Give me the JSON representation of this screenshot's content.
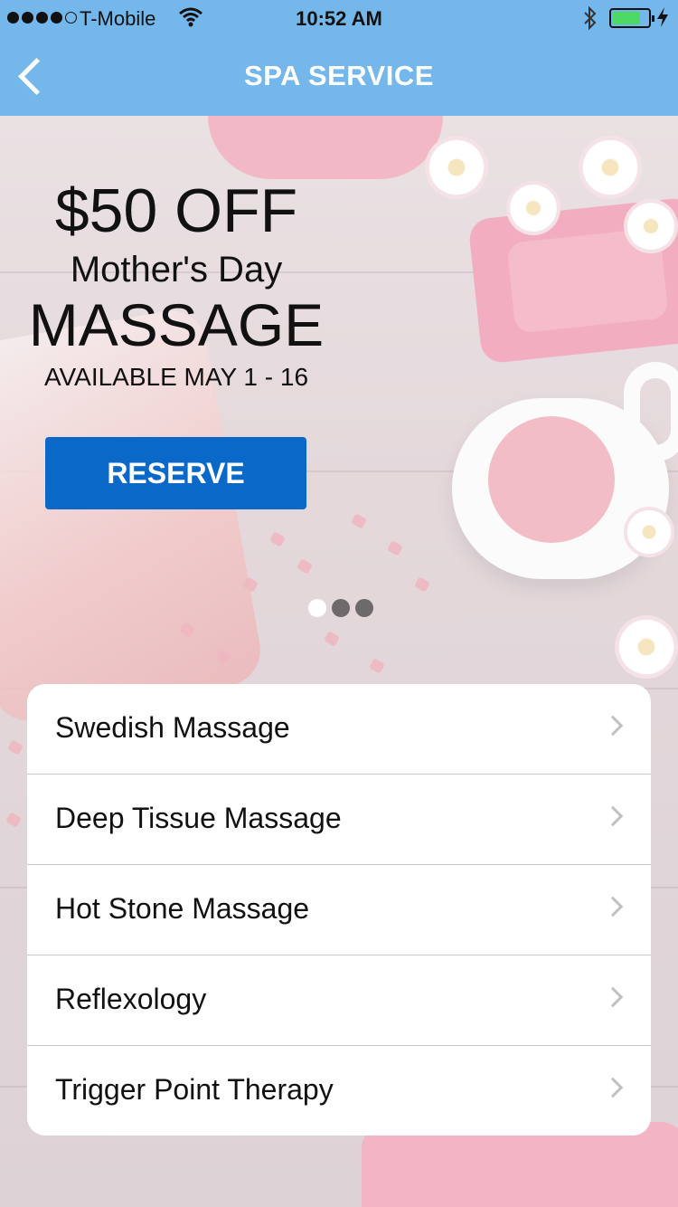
{
  "status_bar": {
    "carrier": "T-Mobile",
    "time": "10:52 AM",
    "signal_bars": 4,
    "signal_total": 5,
    "battery_level": 0.8,
    "icons": [
      "wifi-icon",
      "bluetooth-icon",
      "battery-icon",
      "charging-icon"
    ]
  },
  "nav": {
    "title": "SPA SERVICE",
    "back_icon": "chevron-left-icon"
  },
  "promo": {
    "headline": "$50 OFF",
    "subtitle": "Mother's Day",
    "service": "MASSAGE",
    "availability": "AVAILABLE MAY 1 - 16",
    "button_label": "RESERVE"
  },
  "carousel": {
    "current_page": 1,
    "page_count": 3
  },
  "services": [
    {
      "label": "Swedish Massage"
    },
    {
      "label": "Deep Tissue Massage"
    },
    {
      "label": "Hot Stone Massage"
    },
    {
      "label": "Reflexology"
    },
    {
      "label": "Trigger Point Therapy"
    }
  ],
  "colors": {
    "nav_bar": "#73b7eb",
    "reserve_button": "#0a68c9",
    "battery_fill": "#4cd964"
  }
}
